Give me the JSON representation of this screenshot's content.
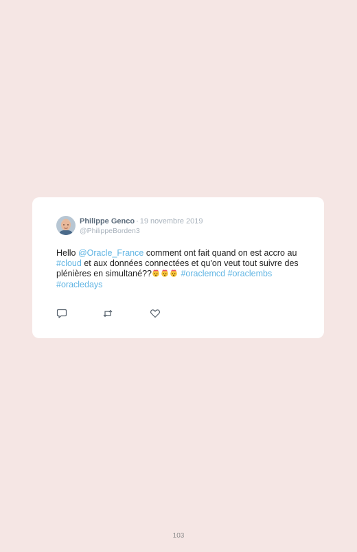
{
  "tweet": {
    "author_name": "Philippe Genco",
    "separator": "·",
    "date": "19 novembre 2019",
    "handle": "@PhilippeBorden3",
    "text_part1": "Hello ",
    "mention": "@Oracle_France",
    "text_part2": " comment ont fait quand on est accro au ",
    "hashtag_cloud": "#cloud",
    "text_part3": " et aux données connectées et qu'on veut tout suivre des plénières en simultané??",
    "emoji_name": "exploding-head-emoji",
    "emoji_count": 3,
    "hashtag_oraclemcd": "#oraclemcd",
    "hashtag_oraclembs": "#oraclembs",
    "hashtag_oracledays": "#oracledays",
    "link_color": "#5fb4e3"
  },
  "actions": {
    "reply_icon": "reply-icon",
    "retweet_icon": "retweet-icon",
    "like_icon": "heart-icon"
  },
  "page": {
    "number": "103",
    "background_color": "#f5e6e4"
  }
}
